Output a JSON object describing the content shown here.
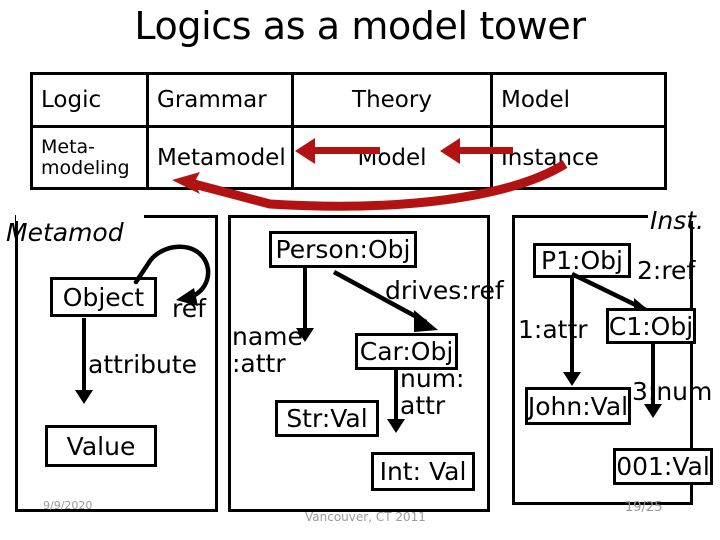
{
  "slide": {
    "title": "Logics as a model tower"
  },
  "table": {
    "rows": [
      {
        "name": "logic-row",
        "cells": [
          "Logic",
          "Grammar",
          "Theory",
          "Model"
        ]
      },
      {
        "name": "metamodeling-row",
        "cells": [
          "Meta-",
          "modeling",
          "Metamodel",
          "Model",
          "Instance"
        ]
      }
    ],
    "arrow_color": "#B21212"
  },
  "panels": {
    "metamodel": {
      "label": "Metamod",
      "nodes": [
        {
          "id": "object",
          "text": "Object"
        },
        {
          "id": "value",
          "text": "Value"
        }
      ],
      "edges": [
        {
          "id": "ref-loop",
          "label": "ref"
        },
        {
          "id": "attribute-edge",
          "label": "attribute"
        }
      ],
      "footer": "9/9/2020"
    },
    "model": {
      "nodes": [
        {
          "id": "person-obj",
          "text": "Person:Obj"
        },
        {
          "id": "car-obj",
          "text": "Car:Obj"
        },
        {
          "id": "str-val",
          "text": "Str:Val"
        },
        {
          "id": "int-val",
          "text": "Int: Val"
        }
      ],
      "edges": [
        {
          "id": "drives-ref",
          "label": "drives:ref"
        },
        {
          "id": "name-attr-line1",
          "label": "name"
        },
        {
          "id": "name-attr-line2",
          "label": ":attr"
        },
        {
          "id": "num-attr-line1",
          "label": "num:"
        },
        {
          "id": "num-attr-line2",
          "label": "attr"
        }
      ],
      "footer": "Vancouver, CT 2011"
    },
    "instance": {
      "label": "Inst.",
      "nodes": [
        {
          "id": "p1-obj",
          "text": "P1:Obj"
        },
        {
          "id": "c1-obj",
          "text": "C1:Obj"
        },
        {
          "id": "john-val",
          "text": "John:Val"
        },
        {
          "id": "001-val",
          "text": "001:Val"
        }
      ],
      "edges": [
        {
          "id": "2-ref",
          "label": "2:ref"
        },
        {
          "id": "1-attr",
          "label": "1:attr"
        },
        {
          "id": "3-num",
          "label": "3:num"
        }
      ],
      "footer": "19/25"
    }
  }
}
